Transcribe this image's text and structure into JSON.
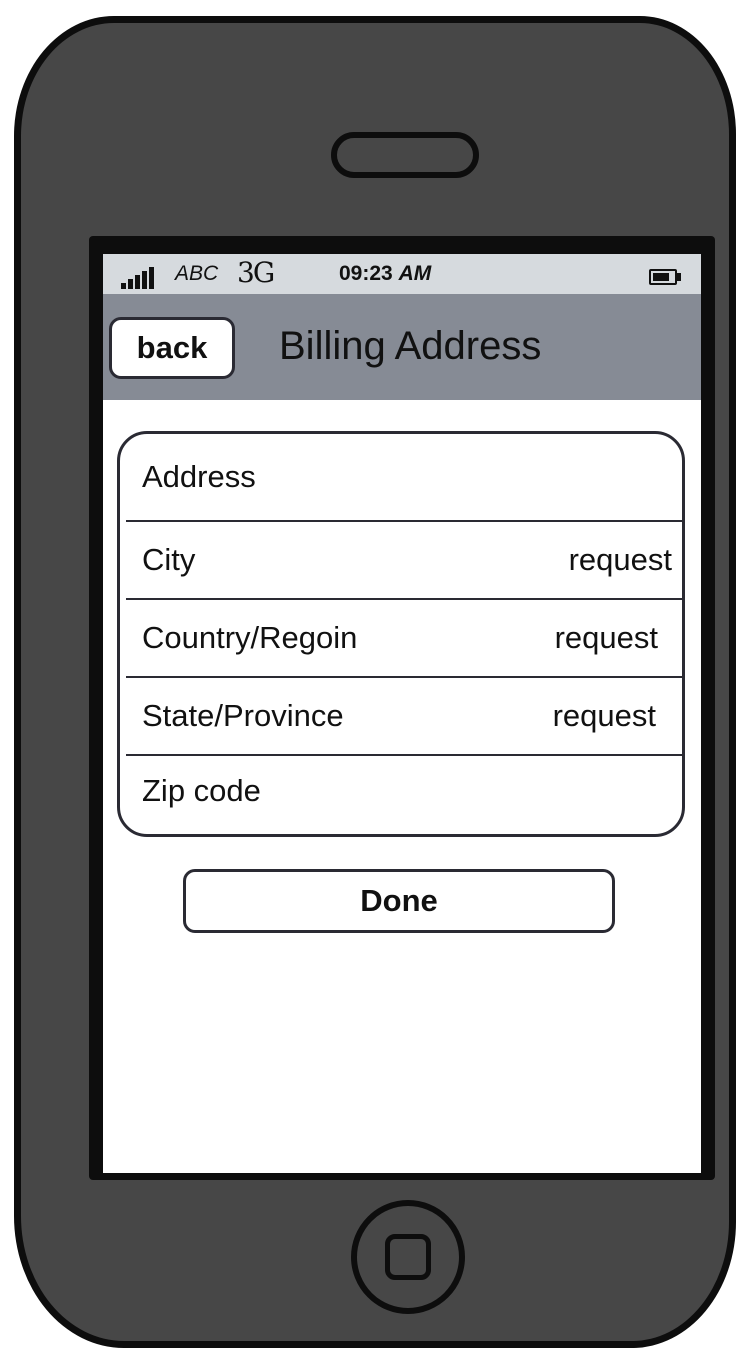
{
  "status_bar": {
    "carrier": "ABC",
    "network": "3G",
    "time": "09:23",
    "ampm": "AM",
    "signal_icon": "signal-bars-icon",
    "battery_icon": "battery-icon"
  },
  "nav": {
    "back_label": "back",
    "title": "Billing Address"
  },
  "form": {
    "rows": [
      {
        "label": "Address",
        "value": ""
      },
      {
        "label": "City",
        "value": "request"
      },
      {
        "label": "Country/Regoin",
        "value": "request"
      },
      {
        "label": "State/Province",
        "value": "request"
      },
      {
        "label": "Zip code",
        "value": ""
      }
    ]
  },
  "actions": {
    "done_label": "Done"
  },
  "colors": {
    "phone_body": "#474747",
    "nav_bar": "#868b95",
    "status_bar": "#d6dade",
    "outline": "#0d0d0d"
  }
}
